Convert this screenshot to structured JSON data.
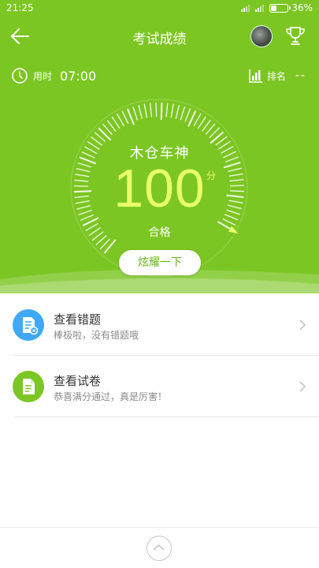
{
  "status_bar": {
    "time": "21:25",
    "battery": "36%",
    "battery_level": 0.36
  },
  "nav": {
    "title": "考试成绩",
    "back_icon": "arrow-left-icon",
    "avatar": "avatar",
    "trophy_icon": "trophy-icon"
  },
  "stats": {
    "time_label": "用时",
    "time_value": "07:00",
    "rank_label": "排名",
    "rank_value": "--"
  },
  "score": {
    "title": "木仓车神",
    "value": "100",
    "unit": "分",
    "result": "合格",
    "progress": 1.0,
    "share_label": "炫耀一下"
  },
  "list": [
    {
      "title": "查看错题",
      "subtitle": "棒极啦，没有错题哦",
      "icon": "wrong-questions-icon",
      "color": "#3fa9f5"
    },
    {
      "title": "查看试卷",
      "subtitle": "恭喜满分通过，真是厉害！",
      "icon": "paper-icon",
      "color": "#7cc623"
    }
  ],
  "colors": {
    "header_green": "#7cc623",
    "score_yellow": "#e8ff6a",
    "blue": "#3fa9f5"
  }
}
